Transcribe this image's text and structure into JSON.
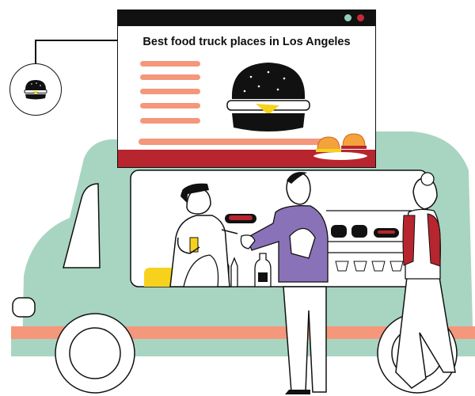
{
  "page": {
    "title": "Best food truck places in Los Angeles"
  },
  "colors": {
    "truck_body": "#a8d5c2",
    "stripe": "#f4977a",
    "accent_red": "#b7252f",
    "purple_shirt": "#8a72b8",
    "ink": "#111111",
    "yellow": "#f7d21c"
  },
  "icons": [
    "burger-icon",
    "hotdog-icon",
    "burger-plate-icon",
    "window-dot-icon"
  ]
}
